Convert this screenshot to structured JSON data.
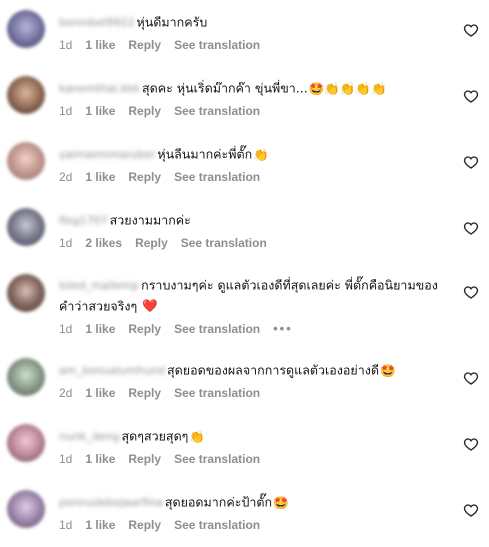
{
  "accent": "#e0245e",
  "muted": "#8e8e8e",
  "comments": [
    {
      "username": "bonnibel9922",
      "text": "หุ่นดีมากครับ",
      "emoji": "",
      "time": "1d",
      "likes": "1 like",
      "reply": "Reply",
      "see_translation": "See translation"
    },
    {
      "username": "kanomthai.kkk",
      "text": "สุดคะ หุ่นเริ่ดม๊ากค๊า ขุ่นพี่ขา...",
      "emoji": "🤩👏👏👏👏",
      "time": "1d",
      "likes": "1 like",
      "reply": "Reply",
      "see_translation": "See translation"
    },
    {
      "username": "yaimaimimaiuber",
      "text": "หุ่นลีนมากค่ะพี่ตั๊ก",
      "emoji": "👏",
      "time": "2d",
      "likes": "1 like",
      "reply": "Reply",
      "see_translation": "See translation"
    },
    {
      "username": "flog1707",
      "text": "สวยงามมากค่ะ",
      "emoji": "",
      "time": "1d",
      "likes": "2 likes",
      "reply": "Reply",
      "see_translation": "See translation"
    },
    {
      "username": "loled_mallemp",
      "text": "กราบงามๆค่ะ ดูแลตัวเองดีที่สุดเลยค่ะ พี่ตั๊กคือนิยามของคำว่าสวยจริงๆ",
      "emoji": "❤️",
      "time": "1d",
      "likes": "1 like",
      "reply": "Reply",
      "see_translation": "See translation",
      "more": "•••"
    },
    {
      "username": "am_bonualumhund",
      "text": "สุดยอดของผลจากการดูแลตัวเองอย่างดี",
      "emoji": "🤩",
      "time": "2d",
      "likes": "1 like",
      "reply": "Reply",
      "see_translation": "See translation"
    },
    {
      "username": "nunk_deng",
      "text": "สุดๆสวยสุดๆ",
      "emoji": "👏",
      "time": "1d",
      "likes": "1 like",
      "reply": "Reply",
      "see_translation": "See translation"
    },
    {
      "username": "ponnudebejaarfina",
      "text": "สุดยอดมากค่ะป้าตั๊ก",
      "emoji": "🤩",
      "time": "1d",
      "likes": "1 like",
      "reply": "Reply",
      "see_translation": "See translation"
    }
  ]
}
